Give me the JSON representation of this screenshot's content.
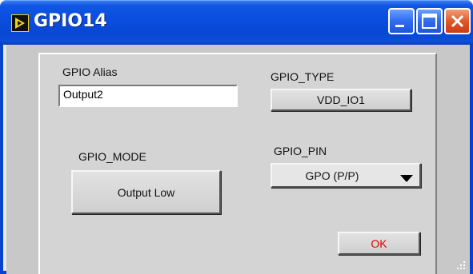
{
  "window": {
    "title": "GPIO14",
    "controls": {
      "minimize": "minimize-icon",
      "maximize": "maximize-icon",
      "close": "close-icon"
    }
  },
  "form": {
    "alias": {
      "label": "GPIO Alias",
      "value": "Output2"
    },
    "type": {
      "label": "GPIO_TYPE",
      "value": "VDD_IO1"
    },
    "mode": {
      "label": "GPIO_MODE",
      "value": "Output Low"
    },
    "pin": {
      "label": "GPIO_PIN",
      "value": "GPO (P/P)",
      "icon": "dropdown-arrow-icon"
    },
    "ok": {
      "label": "OK",
      "color": "#e00000"
    }
  },
  "colors": {
    "titlebar": "#0a4ddf",
    "panel": "#d4d4d4",
    "frame": "#c8c8c8"
  }
}
